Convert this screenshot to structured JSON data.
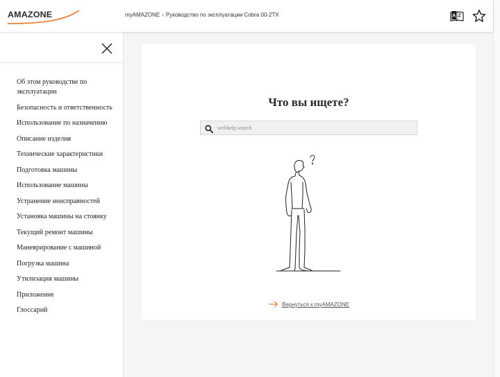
{
  "header": {
    "logo_text": "AMAZONE",
    "breadcrumb": {
      "home": "myAMAZONE",
      "separator": "›",
      "current": "Руководство по эксплуатации Cobra 00-2TX"
    },
    "icons": [
      "dictionary-icon",
      "star-icon"
    ]
  },
  "sidebar": {
    "close_icon": "close-icon",
    "items": [
      "Об этом руководстве по эксплуатации",
      "Безопасность и ответственность",
      "Использование по назначению",
      "Описание изделия",
      "Технические характеристики",
      "Подготовка машины",
      "Использование машины",
      "Устранение неисправностей",
      "Установка машины на стоянку",
      "Текущий ремонт машины",
      "Маневрирование с машиной",
      "Погрузка машина",
      "Утилизация машины",
      "Приложение",
      "Глоссарий"
    ]
  },
  "main": {
    "title": "Что вы ищете?",
    "search": {
      "placeholder": "webhelp.search",
      "value": ""
    },
    "back_link": "Вернуться к myAMAZONE"
  },
  "colors": {
    "accent": "#e8823a",
    "background": "#f5f5f5",
    "card": "#ffffff"
  }
}
